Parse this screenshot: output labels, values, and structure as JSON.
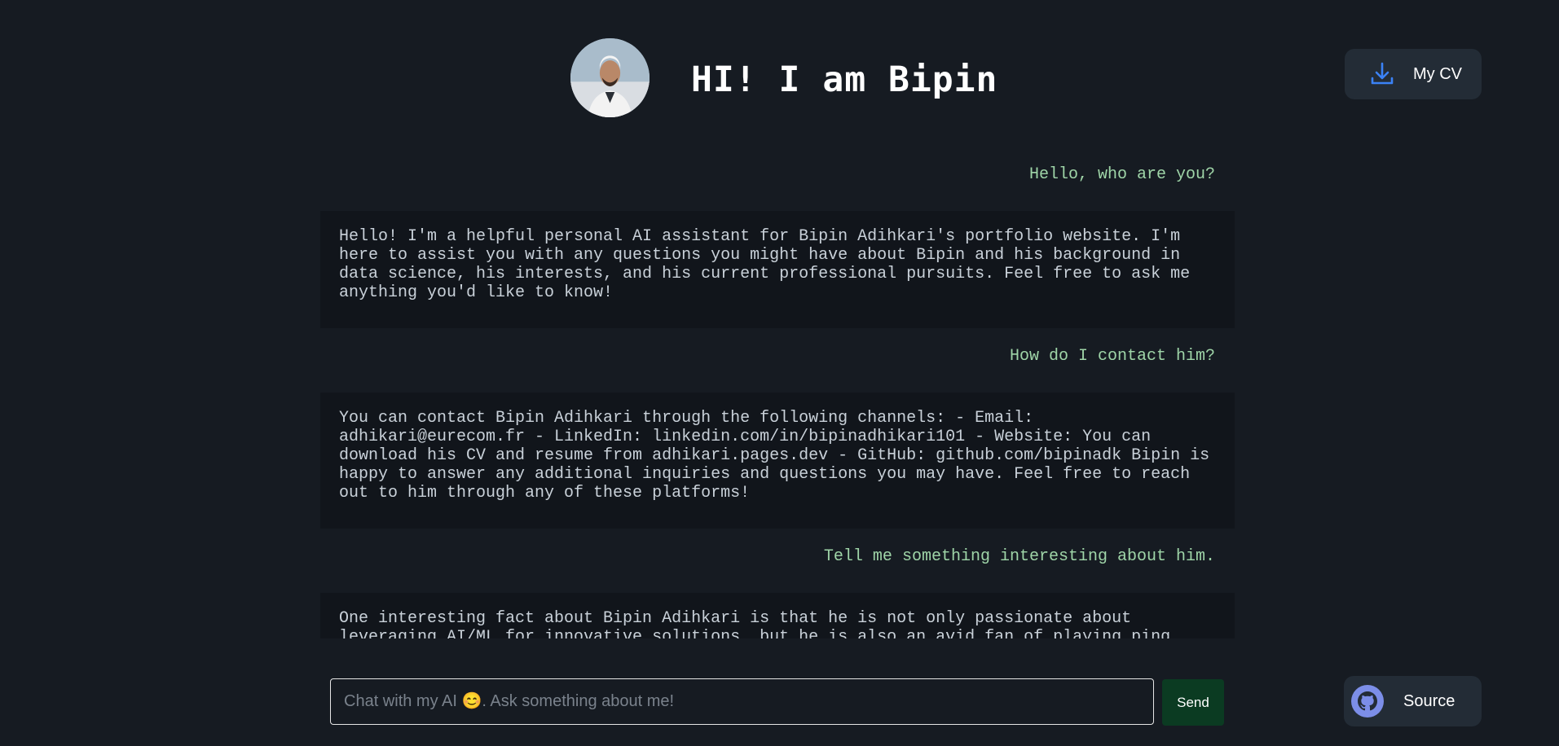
{
  "header": {
    "title": "HI! I am Bipin",
    "avatar_icon": "profile-photo"
  },
  "cv_button": {
    "label": "My CV",
    "icon": "download-icon"
  },
  "chat": {
    "messages": [
      {
        "role": "user",
        "text": "Hello, who are you?"
      },
      {
        "role": "assistant",
        "text": "Hello! I'm a helpful personal AI assistant for Bipin Adihkari's portfolio website. I'm here to assist you with any questions you might have about Bipin and his background in data science, his interests, and his current professional pursuits. Feel free to ask me anything you'd like to know!"
      },
      {
        "role": "user",
        "text": "How do I contact him?"
      },
      {
        "role": "assistant",
        "text": "You can contact Bipin Adihkari through the following channels: - Email: adhikari@eurecom.fr - LinkedIn: linkedin.com/in/bipinadhikari101 - Website: You can download his CV and resume from adhikari.pages.dev - GitHub: github.com/bipinadk Bipin is happy to answer any additional inquiries and questions you may have. Feel free to reach out to him through any of these platforms!"
      },
      {
        "role": "user",
        "text": "Tell me something interesting about him."
      },
      {
        "role": "assistant",
        "text": "One interesting fact about Bipin Adihkari is that he is not only passionate about leveraging AI/ML for innovative solutions, but he is also an avid fan of playing ping pong, engaging in VR games, and biking. Beyond his technical skills and projects in the"
      }
    ]
  },
  "input": {
    "placeholder": "Chat with my AI 😊. Ask something about me!",
    "value": ""
  },
  "send_button": {
    "label": "Send"
  },
  "source_button": {
    "label": "Source",
    "icon": "github-icon"
  },
  "colors": {
    "background": "#161b22",
    "user_text": "#9fd5a8",
    "assistant_bg": "#11151b",
    "send_bg": "#0b3b22",
    "download_icon": "#3b82f6",
    "github_icon": "#7c8ee8"
  }
}
